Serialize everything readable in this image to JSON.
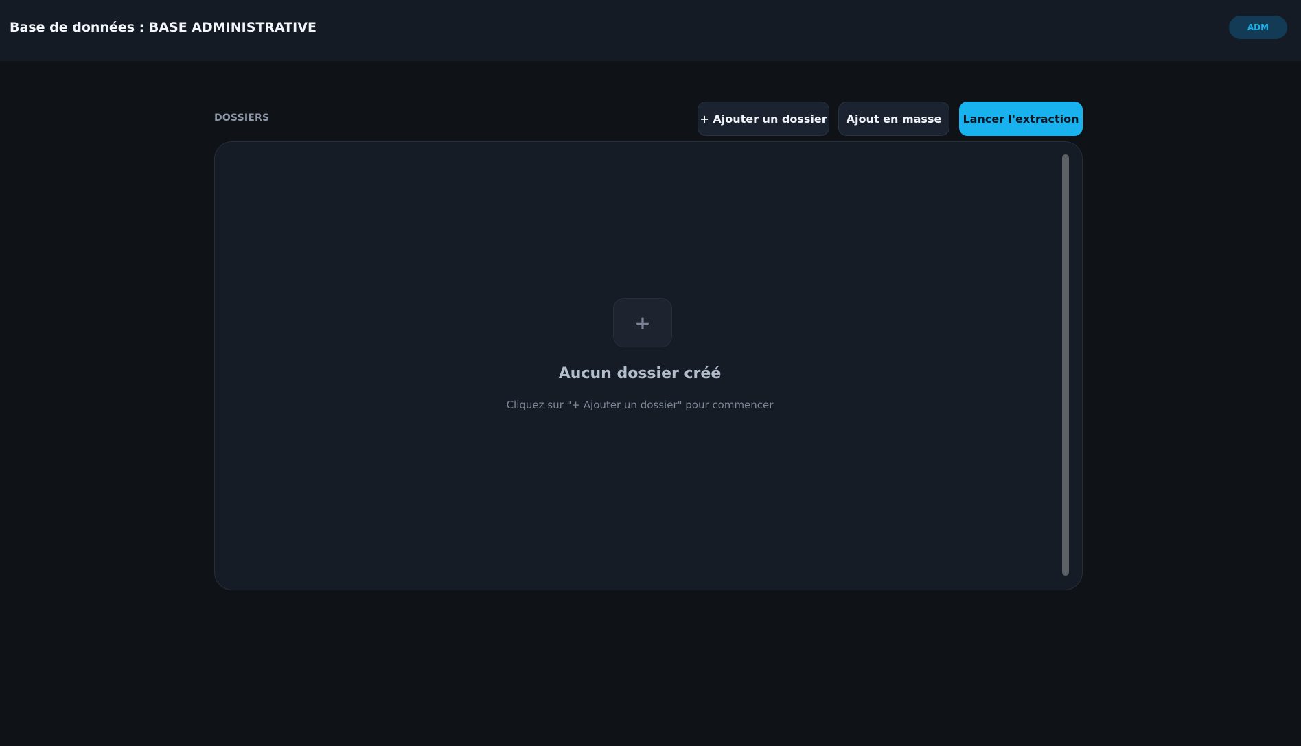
{
  "header": {
    "title": "Base de données : BASE ADMINISTRATIVE",
    "user_badge": "ADM"
  },
  "section": {
    "label": "DOSSIERS"
  },
  "toolbar": {
    "add_folder_label": "+ Ajouter un dossier",
    "bulk_add_label": "Ajout en masse",
    "extract_label": "Lancer l'extraction"
  },
  "empty_state": {
    "icon_glyph": "+",
    "icon": "plus-icon",
    "title": "Aucun dossier créé",
    "subtitle": "Cliquez sur \"+ Ajouter un dossier\" pour commencer"
  },
  "colors": {
    "background": "#0f1318",
    "header_bg": "#151b24",
    "panel_bg": "#161c26",
    "accent": "#18b2ef",
    "badge_bg": "#133b55",
    "badge_text": "#1ab0ea"
  }
}
